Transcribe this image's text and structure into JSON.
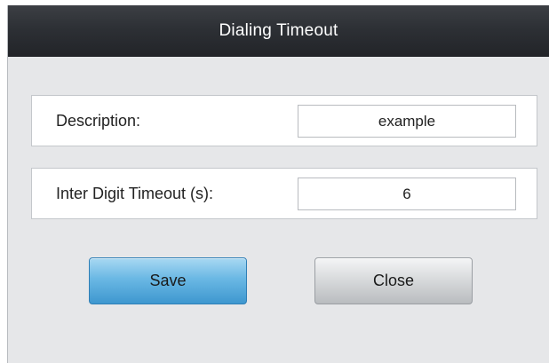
{
  "dialog": {
    "title": "Dialing Timeout"
  },
  "form": {
    "description": {
      "label": "Description:",
      "value": "example"
    },
    "inter_digit_timeout": {
      "label": "Inter Digit Timeout (s):",
      "value": "6"
    }
  },
  "buttons": {
    "save_label": "Save",
    "close_label": "Close"
  }
}
